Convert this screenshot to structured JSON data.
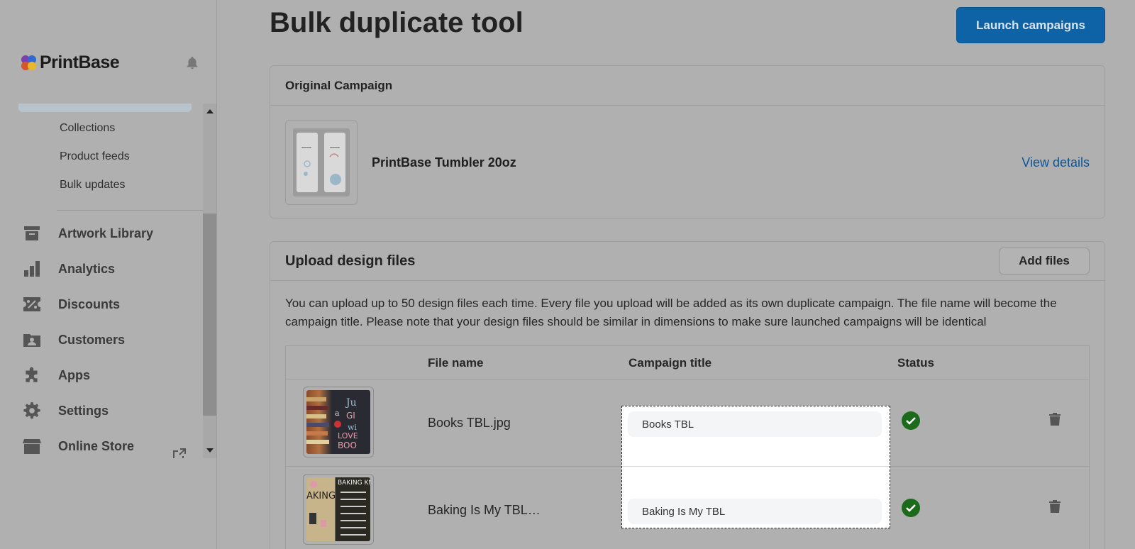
{
  "brand": {
    "name": "PrintBase"
  },
  "sidebar": {
    "subitems": [
      "Collections",
      "Product feeds",
      "Bulk updates"
    ],
    "items": [
      {
        "label": "Artwork Library",
        "icon": "archive-icon"
      },
      {
        "label": "Analytics",
        "icon": "bar-chart-icon"
      },
      {
        "label": "Discounts",
        "icon": "discount-icon"
      },
      {
        "label": "Customers",
        "icon": "customers-icon"
      },
      {
        "label": "Apps",
        "icon": "puzzle-icon"
      },
      {
        "label": "Settings",
        "icon": "gear-icon"
      },
      {
        "label": "Online Store",
        "icon": "store-icon"
      }
    ]
  },
  "header": {
    "title": "Bulk duplicate tool",
    "launch_label": "Launch campaigns"
  },
  "original_campaign": {
    "heading": "Original Campaign",
    "product_name": "PrintBase Tumbler 20oz",
    "view_details": "View details"
  },
  "upload": {
    "heading": "Upload design files",
    "add_files_label": "Add files",
    "description": "You can upload up to 50 design files each time. Every file you upload will be added as its own duplicate campaign. The file name will become the campaign title. Please note that your design files should be similar in dimensions to make sure launched campaigns will be identical",
    "columns": {
      "file_name": "File name",
      "campaign_title": "Campaign title",
      "status": "Status"
    },
    "rows": [
      {
        "file_name": "Books TBL.jpg",
        "campaign_title": "Books TBL",
        "status": "success"
      },
      {
        "file_name": "Baking Is My TBL…",
        "campaign_title": "Baking Is My TBL",
        "status": "success"
      }
    ]
  },
  "colors": {
    "accent": "#0d63a5",
    "success": "#1c6a1c",
    "link": "#0d5694"
  }
}
